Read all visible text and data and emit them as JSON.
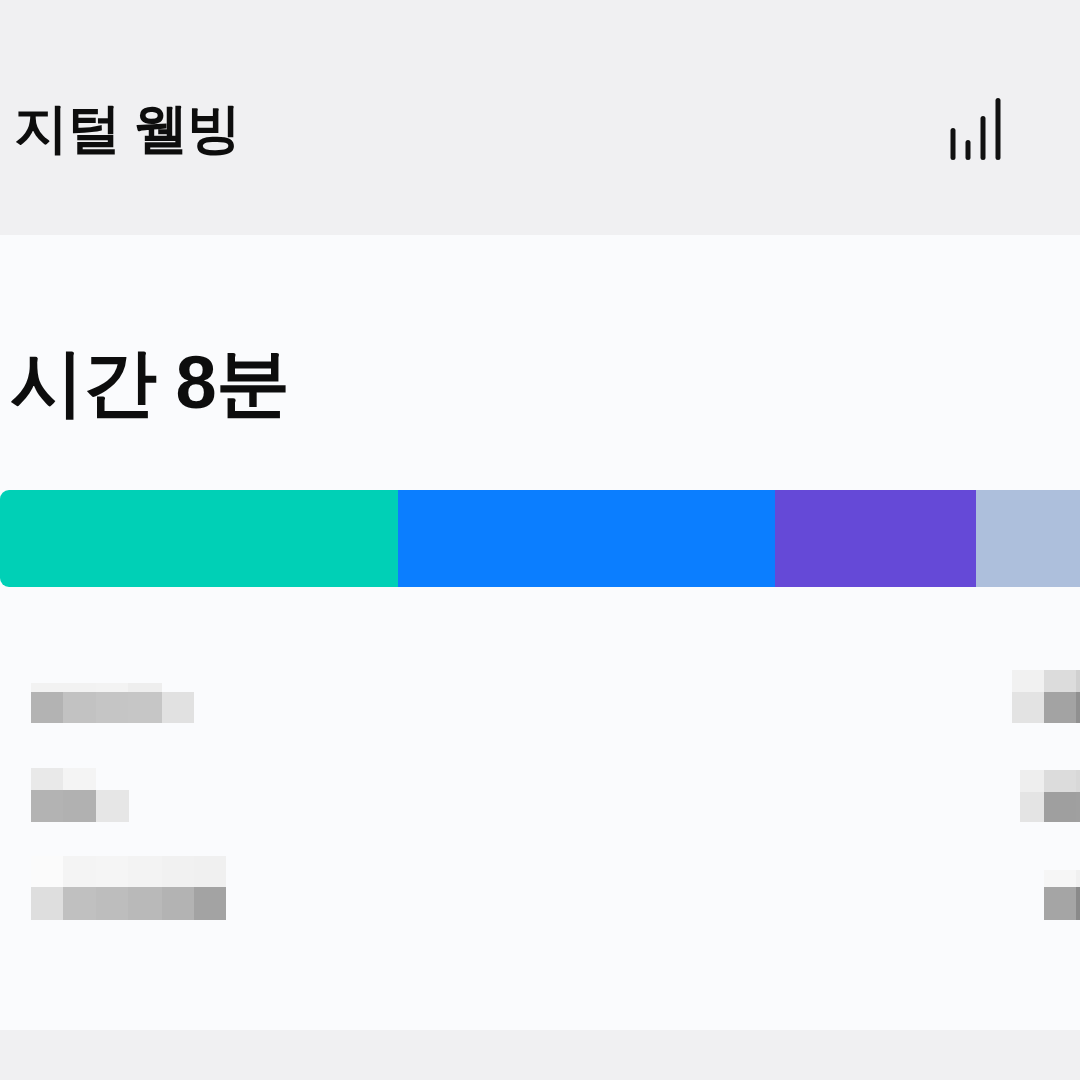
{
  "header": {
    "title": "지털 웰빙"
  },
  "summary": {
    "total_time": "시간 8분"
  }
}
